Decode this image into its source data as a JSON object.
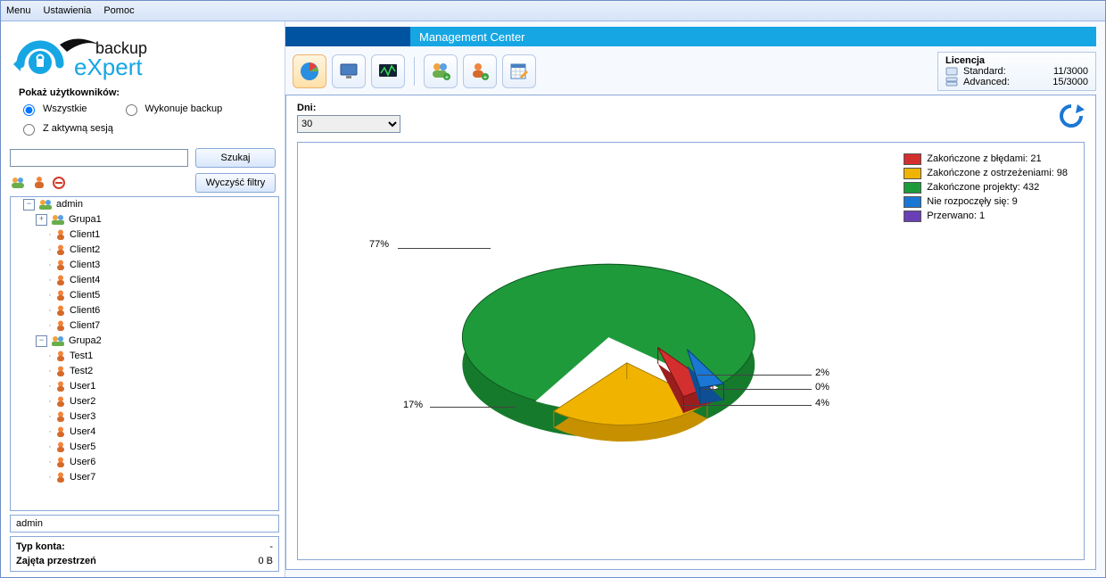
{
  "menu": {
    "items": [
      "Menu",
      "Ustawienia",
      "Pomoc"
    ]
  },
  "logo": {
    "line1": "backup",
    "line2": "eXpert"
  },
  "filters": {
    "header": "Pokaż użytkowników:",
    "opt_all": "Wszystkie",
    "opt_backup": "Wykonuje backup",
    "opt_active": "Z aktywną sesją",
    "search_btn": "Szukaj",
    "clear_btn": "Wyczyść filtry"
  },
  "tree": {
    "root": "admin",
    "group1": "Grupa1",
    "group1_children": [
      "Client1",
      "Client2",
      "Client3",
      "Client4",
      "Client5",
      "Client6",
      "Client7"
    ],
    "group2": "Grupa2",
    "group2_children": [
      "Test1",
      "Test2",
      "User1",
      "User2",
      "User3",
      "User4",
      "User5",
      "User6",
      "User7"
    ]
  },
  "status_user": "admin",
  "account": {
    "type_label": "Typ konta:",
    "type_value": "-",
    "space_label": "Zajęta przestrzeń",
    "space_value": "0 B"
  },
  "header_title": "Management Center",
  "license": {
    "title": "Licencja",
    "standard_label": "Standard:",
    "standard_value": "11/3000",
    "advanced_label": "Advanced:",
    "advanced_value": "15/3000"
  },
  "days_label": "Dni:",
  "days_value": "30",
  "chart_data": {
    "type": "pie",
    "series": [
      {
        "name": "Zakończone z błędami",
        "value": 21,
        "pct": 4,
        "color": "#d42f2f"
      },
      {
        "name": "Zakończone z ostrzeżeniami",
        "value": 98,
        "pct": 17,
        "color": "#f0b400"
      },
      {
        "name": "Zakończone projekty",
        "value": 432,
        "pct": 77,
        "color": "#1f9a3b"
      },
      {
        "name": "Nie rozpoczęły się",
        "value": 9,
        "pct": 2,
        "color": "#1b77d4"
      },
      {
        "name": "Przerwano",
        "value": 1,
        "pct": 0,
        "color": "#6a3fb5"
      }
    ],
    "legend_labels": [
      "Zakończone z błędami: 21",
      "Zakończone z ostrzeżeniami: 98",
      "Zakończone projekty: 432",
      "Nie rozpoczęły się: 9",
      "Przerwano: 1"
    ],
    "callouts": [
      "77%",
      "17%",
      "4%",
      "2%",
      "0%"
    ]
  }
}
